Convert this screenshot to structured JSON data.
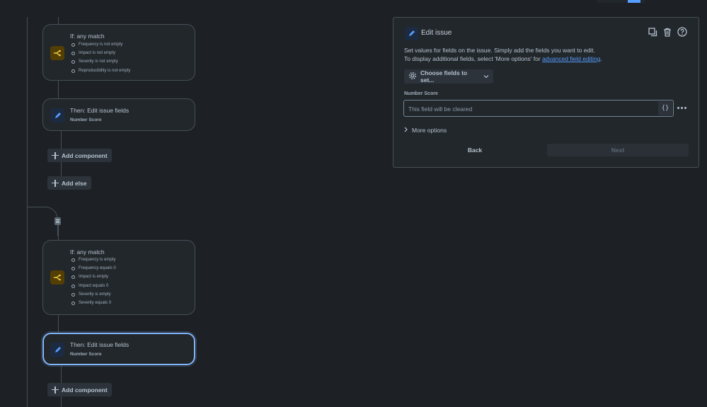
{
  "canvas": {
    "block1": {
      "condition": {
        "title": "If: any match",
        "items": [
          "Frequency is not empty",
          "Impact is not empty",
          "Severity is not empty",
          "Reproducibility is not empty"
        ]
      },
      "action": {
        "title": "Then: Edit issue fields",
        "subtitle": "Number Score"
      },
      "add_component_label": "Add component",
      "add_else_label": "Add else"
    },
    "block2": {
      "condition": {
        "title": "If: any match",
        "items": [
          "Frequency is empty",
          "Frequency equals 0",
          "Impact is empty",
          "Impact equals 0",
          "Severity is empty",
          "Severity equals 0"
        ]
      },
      "action": {
        "title": "Then: Edit issue fields",
        "subtitle": "Number Score"
      },
      "add_component_label": "Add component"
    }
  },
  "panel": {
    "title": "Edit issue",
    "description_line1": "Set values for fields on the issue. Simply add the fields you want to edit.",
    "description_line2_prefix": "To display additional fields, select 'More options' for ",
    "description_link": "advanced field editing",
    "description_suffix": ".",
    "choose_fields_label": "Choose fields to set...",
    "field": {
      "label": "Number Score",
      "value": "",
      "placeholder": "This field will be cleared",
      "smart_value_glyph": "{}"
    },
    "more_options_label": "More options",
    "back_label": "Back",
    "next_label": "Next"
  },
  "colors": {
    "background": "#1d2125",
    "card": "#22272b",
    "accent": "#579dff",
    "selected_border": "#85b8ff",
    "condition_icon": "#f5cd47"
  },
  "icons": {
    "condition": "branch-icon",
    "action": "pencil-icon",
    "duplicate": "duplicate-icon",
    "delete": "trash-icon",
    "help": "help-icon",
    "settings": "gear-icon"
  }
}
